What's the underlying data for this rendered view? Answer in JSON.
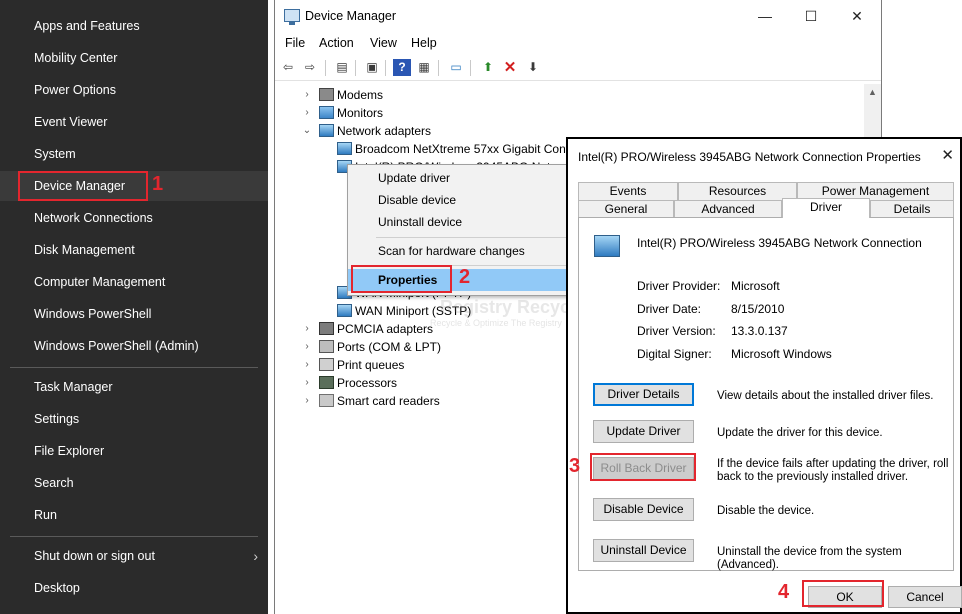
{
  "winx_menu": {
    "items": [
      "Apps and Features",
      "Mobility Center",
      "Power Options",
      "Event Viewer",
      "System",
      "Device Manager",
      "Network Connections",
      "Disk Management",
      "Computer Management",
      "Windows PowerShell",
      "Windows PowerShell (Admin)",
      "Task Manager",
      "Settings",
      "File Explorer",
      "Search",
      "Run",
      "Shut down or sign out",
      "Desktop"
    ],
    "submenu_chevron": "chevron-right-icon"
  },
  "device_manager": {
    "title": "Device Manager",
    "controls": {
      "minimize": "—",
      "maximize": "☐",
      "close": "✕"
    },
    "menu": [
      "File",
      "Action",
      "View",
      "Help"
    ],
    "toolbar_icons": [
      "back-arrow-icon",
      "forward-arrow-icon",
      "properties-grid-icon",
      "console-tree-icon",
      "help-icon",
      "view-grid-icon",
      "scan-monitor-icon",
      "update-driver-icon",
      "uninstall-x-icon",
      "download-arrow-icon"
    ],
    "tree": [
      {
        "label": "Modems",
        "expander": "›",
        "icon": "modem"
      },
      {
        "label": "Monitors",
        "expander": "›",
        "icon": "mon"
      },
      {
        "label": "Network adapters",
        "expander": "⌄",
        "icon": "net"
      },
      {
        "label": "Broadcom NetXtreme 57xx Gigabit Controller",
        "expander": "",
        "icon": "net"
      },
      {
        "label": "Intel(R) PRO/Wireless 3945ABG Network Connection",
        "expander": "",
        "icon": "net"
      },
      {
        "label": "WAN Miniport (PPTP)",
        "expander": "",
        "icon": "net"
      },
      {
        "label": "WAN Miniport (SSTP)",
        "expander": "",
        "icon": "net"
      },
      {
        "label": "PCMCIA adapters",
        "expander": "›",
        "icon": "pcmcia"
      },
      {
        "label": "Ports (COM & LPT)",
        "expander": "›",
        "icon": "port"
      },
      {
        "label": "Print queues",
        "expander": "›",
        "icon": "print"
      },
      {
        "label": "Processors",
        "expander": "›",
        "icon": "cpu"
      },
      {
        "label": "Smart card readers",
        "expander": "›",
        "icon": "smart"
      }
    ]
  },
  "context_menu": {
    "items": [
      "Update driver",
      "Disable device",
      "Uninstall device",
      "Scan for hardware changes",
      "Properties"
    ]
  },
  "watermark": {
    "title": "Registry Recycler",
    "tagline": "Recycle & Optimize The Registry"
  },
  "annotations": {
    "step1": "1",
    "step2": "2",
    "step3": "3",
    "step4": "4",
    "color": "#e3262e"
  },
  "properties_dialog": {
    "title": "Intel(R) PRO/Wireless 3945ABG Network Connection Properties",
    "close": "✕",
    "tabs_top": [
      "Events",
      "Resources",
      "Power Management"
    ],
    "tabs_bottom": [
      "General",
      "Advanced",
      "Driver",
      "Details"
    ],
    "active_tab": "Driver",
    "device_name": "Intel(R) PRO/Wireless 3945ABG Network Connection",
    "fields": [
      {
        "key": "Driver Provider:",
        "value": "Microsoft"
      },
      {
        "key": "Driver Date:",
        "value": "8/15/2010"
      },
      {
        "key": "Driver Version:",
        "value": "13.3.0.137"
      },
      {
        "key": "Digital Signer:",
        "value": "Microsoft Windows"
      }
    ],
    "actions": [
      {
        "button": "Driver Details",
        "description": "View details about the installed driver files."
      },
      {
        "button": "Update Driver",
        "description": "Update the driver for this device."
      },
      {
        "button": "Roll Back Driver",
        "description": "If the device fails after updating the driver, roll back to the previously installed driver."
      },
      {
        "button": "Disable Device",
        "description": "Disable the device."
      },
      {
        "button": "Uninstall Device",
        "description": "Uninstall the device from the system (Advanced)."
      }
    ],
    "ok_label": "OK",
    "cancel_label": "Cancel"
  }
}
